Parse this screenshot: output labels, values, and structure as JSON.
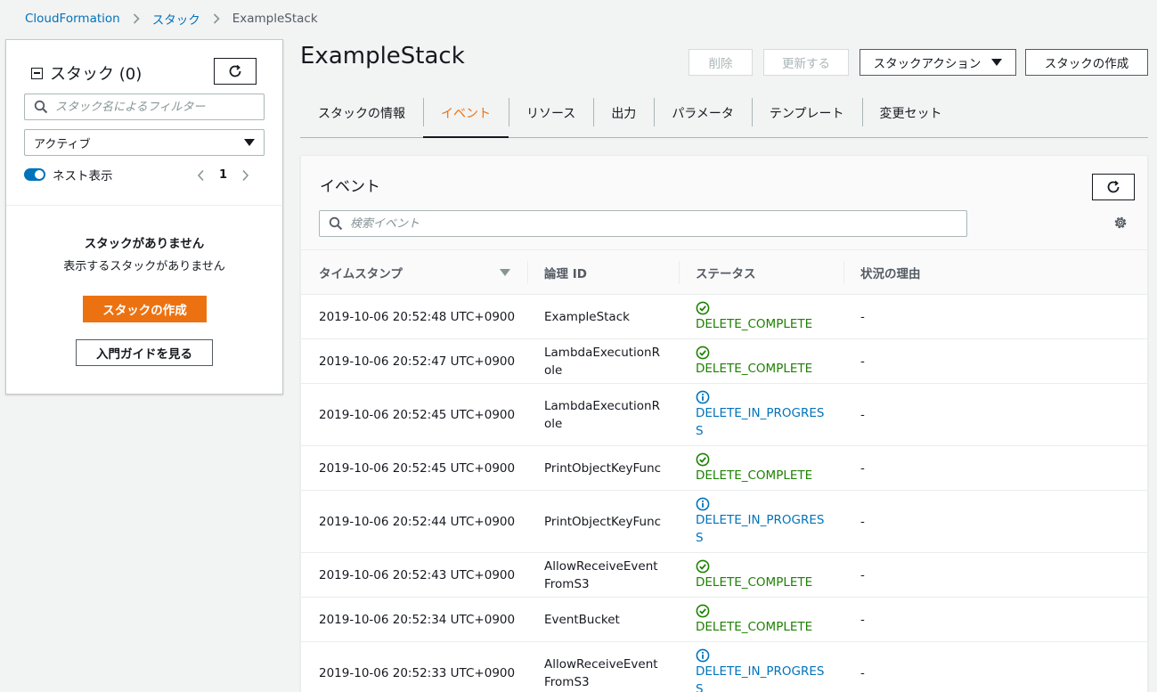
{
  "breadcrumb": {
    "items": [
      "CloudFormation",
      "スタック"
    ],
    "current": "ExampleStack"
  },
  "left_panel": {
    "title": "スタック (0)",
    "filter_placeholder": "スタック名によるフィルター",
    "filter_select": "アクティブ",
    "nested_toggle_label": "ネスト表示",
    "nested_toggle_on": true,
    "page": "1",
    "empty_title": "スタックがありません",
    "empty_desc": "表示するスタックがありません",
    "create_button": "スタックの作成",
    "guide_button": "入門ガイドを見る"
  },
  "main": {
    "stack_name": "ExampleStack",
    "buttons": {
      "delete": "削除",
      "update": "更新する",
      "stack_actions": "スタックアクション",
      "create": "スタックの作成"
    },
    "tabs": [
      {
        "label": "スタックの情報",
        "active": false
      },
      {
        "label": "イベント",
        "active": true
      },
      {
        "label": "リソース",
        "active": false
      },
      {
        "label": "出力",
        "active": false
      },
      {
        "label": "パラメータ",
        "active": false
      },
      {
        "label": "テンプレート",
        "active": false
      },
      {
        "label": "変更セット",
        "active": false
      }
    ]
  },
  "events": {
    "title": "イベント",
    "search_placeholder": "検索イベント",
    "columns": [
      "タイムスタンプ",
      "論理 ID",
      "ステータス",
      "状況の理由"
    ],
    "rows": [
      {
        "timestamp": "2019-10-06 20:52:48 UTC+0900",
        "logical_id": "ExampleStack",
        "status": "DELETE_COMPLETE",
        "status_type": "ok",
        "reason": "-"
      },
      {
        "timestamp": "2019-10-06 20:52:47 UTC+0900",
        "logical_id": "LambdaExecutionRole",
        "status": "DELETE_COMPLETE",
        "status_type": "ok",
        "reason": "-"
      },
      {
        "timestamp": "2019-10-06 20:52:45 UTC+0900",
        "logical_id": "LambdaExecutionRole",
        "status": "DELETE_IN_PROGRESS",
        "status_type": "info",
        "reason": "-"
      },
      {
        "timestamp": "2019-10-06 20:52:45 UTC+0900",
        "logical_id": "PrintObjectKeyFunc",
        "status": "DELETE_COMPLETE",
        "status_type": "ok",
        "reason": "-"
      },
      {
        "timestamp": "2019-10-06 20:52:44 UTC+0900",
        "logical_id": "PrintObjectKeyFunc",
        "status": "DELETE_IN_PROGRESS",
        "status_type": "info",
        "reason": "-"
      },
      {
        "timestamp": "2019-10-06 20:52:43 UTC+0900",
        "logical_id": "AllowReceiveEventFromS3",
        "status": "DELETE_COMPLETE",
        "status_type": "ok",
        "reason": "-"
      },
      {
        "timestamp": "2019-10-06 20:52:34 UTC+0900",
        "logical_id": "EventBucket",
        "status": "DELETE_COMPLETE",
        "status_type": "ok",
        "reason": "-"
      },
      {
        "timestamp": "2019-10-06 20:52:33 UTC+0900",
        "logical_id": "AllowReceiveEventFromS3",
        "status": "DELETE_IN_PROGRESS",
        "status_type": "info",
        "reason": "-"
      }
    ]
  },
  "colors": {
    "accent": "#ec7211",
    "link": "#0073bb",
    "ok": "#1d8102"
  },
  "icons": {
    "refresh": "refresh-icon",
    "search": "search-icon",
    "settings": "gear-icon",
    "ok": "check-circle-icon",
    "info": "info-circle-icon"
  }
}
